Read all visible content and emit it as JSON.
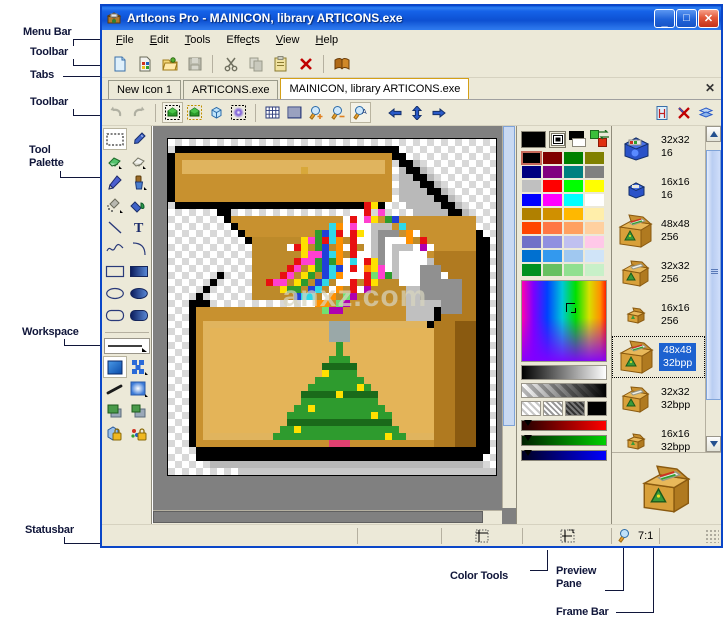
{
  "annotations": [
    {
      "id": "menu-bar",
      "text": "Menu Bar"
    },
    {
      "id": "toolbar-top",
      "text": "Toolbar"
    },
    {
      "id": "tabs",
      "text": "Tabs"
    },
    {
      "id": "toolbar-2",
      "text": "Toolbar"
    },
    {
      "id": "tool-palette",
      "text": "Tool\nPalette"
    },
    {
      "id": "workspace",
      "text": "Workspace"
    },
    {
      "id": "statusbar",
      "text": "Statusbar"
    },
    {
      "id": "color-tools",
      "text": "Color Tools"
    },
    {
      "id": "preview-pane",
      "text": "Preview\nPane"
    },
    {
      "id": "frame-bar",
      "text": "Frame Bar"
    }
  ],
  "window": {
    "title": "ArtIcons Pro - MAINICON, library ARTICONS.exe",
    "minimize_label": "_",
    "maximize_label": "□",
    "close_label": "✕",
    "titlebar_color": "#0b5ae0"
  },
  "menubar": {
    "items": [
      {
        "label": "File",
        "accel": "F"
      },
      {
        "label": "Edit",
        "accel": "E"
      },
      {
        "label": "Tools",
        "accel": "T"
      },
      {
        "label": "Effects",
        "accel": "c"
      },
      {
        "label": "View",
        "accel": "V"
      },
      {
        "label": "Help",
        "accel": "H"
      }
    ]
  },
  "toolbar_main": {
    "buttons": [
      {
        "name": "new-icon-button",
        "icon": "new-document-icon"
      },
      {
        "name": "new-library-button",
        "icon": "new-library-icon"
      },
      {
        "name": "open-button",
        "icon": "open-folder-icon"
      },
      {
        "name": "save-button",
        "icon": "floppy-disk-icon",
        "disabled": true
      },
      {
        "name": "cut-button",
        "icon": "scissors-icon"
      },
      {
        "name": "copy-button",
        "icon": "copy-icon",
        "disabled": true
      },
      {
        "name": "paste-button",
        "icon": "clipboard-icon"
      },
      {
        "name": "delete-button",
        "icon": "red-x-icon"
      },
      {
        "name": "help-button",
        "icon": "book-icon"
      }
    ]
  },
  "tabs": {
    "items": [
      {
        "label": "New Icon 1",
        "active": false
      },
      {
        "label": "ARTICONS.exe",
        "active": false
      },
      {
        "label": "MAINICON, library ARTICONS.exe",
        "active": true
      }
    ],
    "close_label": "✕"
  },
  "toolbar_edit": {
    "buttons": [
      {
        "name": "undo-button",
        "icon": "undo-arrow-icon"
      },
      {
        "name": "redo-button",
        "icon": "redo-arrow-icon"
      },
      {
        "name": "image-normal-button",
        "icon": "green-cube-icon",
        "selected": true
      },
      {
        "name": "image-selected-button",
        "icon": "green-cube-dashed-icon"
      },
      {
        "name": "image-3d-button",
        "icon": "blue-cube-icon"
      },
      {
        "name": "blur-button",
        "icon": "blur-blob-icon"
      },
      {
        "name": "grid-button",
        "icon": "grid-icon"
      },
      {
        "name": "fine-grid-button",
        "icon": "fine-grid-icon"
      },
      {
        "name": "zoom-in-button",
        "icon": "magnifier-plus-icon"
      },
      {
        "name": "zoom-out-button",
        "icon": "magnifier-minus-icon"
      },
      {
        "name": "zoom-actual-button",
        "icon": "magnifier-a-icon",
        "selected": true
      },
      {
        "name": "nudge-left-button",
        "icon": "arrow-left-icon"
      },
      {
        "name": "nudge-vertical-button",
        "icon": "arrow-updown-icon"
      },
      {
        "name": "nudge-right-button",
        "icon": "arrow-right-icon"
      },
      {
        "name": "add-frame-button",
        "icon": "add-frame-icon"
      },
      {
        "name": "delete-frame-button",
        "icon": "delete-frame-icon"
      },
      {
        "name": "layers-button",
        "icon": "layers-icon"
      }
    ]
  },
  "tool_palette": {
    "tools": [
      {
        "name": "select-rectangle-tool",
        "icon": "marquee-icon",
        "selected": true
      },
      {
        "name": "color-picker-tool",
        "icon": "eyedropper-icon",
        "selected": false
      },
      {
        "name": "eraser-tool",
        "icon": "eraser-green-icon",
        "selected": false
      },
      {
        "name": "erase-all-tool",
        "icon": "eraser-white-icon",
        "selected": false
      },
      {
        "name": "pencil-tool",
        "icon": "pencil-icon",
        "selected": false
      },
      {
        "name": "brush-tool",
        "icon": "paintbrush-icon",
        "selected": false
      },
      {
        "name": "airbrush-tool",
        "icon": "airbrush-icon",
        "selected": false
      },
      {
        "name": "paint-bucket-tool",
        "icon": "paint-bucket-icon",
        "selected": false
      },
      {
        "name": "line-tool",
        "icon": "line-icon",
        "selected": false
      },
      {
        "name": "text-tool",
        "icon": "text-t-icon",
        "selected": false
      },
      {
        "name": "curve-tool",
        "icon": "wave-icon",
        "selected": false
      },
      {
        "name": "arc-tool",
        "icon": "arc-icon",
        "selected": false
      },
      {
        "name": "rectangle-tool",
        "icon": "rectangle-outline-icon",
        "selected": false
      },
      {
        "name": "rectangle-filled-tool",
        "icon": "rectangle-filled-icon",
        "selected": false
      },
      {
        "name": "ellipse-tool",
        "icon": "ellipse-outline-icon",
        "selected": false
      },
      {
        "name": "ellipse-filled-tool",
        "icon": "ellipse-filled-icon",
        "selected": false
      },
      {
        "name": "rounded-rect-tool",
        "icon": "rounded-rect-outline-icon",
        "selected": false
      },
      {
        "name": "rounded-rect-filled-tool",
        "icon": "rounded-rect-filled-icon",
        "selected": false
      }
    ],
    "options": [
      {
        "name": "line-width-selector",
        "icon": "line-width-icon"
      },
      {
        "name": "fill-solid-option",
        "icon": "solid-fill-icon",
        "selected": true
      },
      {
        "name": "fill-pattern-option",
        "icon": "pattern-fill-icon"
      },
      {
        "name": "stroke-style-option",
        "icon": "stroke-style-icon"
      },
      {
        "name": "gradient-fill-option",
        "icon": "gradient-fill-icon"
      },
      {
        "name": "opaque-option",
        "icon": "opaque-layers-icon"
      },
      {
        "name": "transparent-option",
        "icon": "transparent-layers-icon"
      },
      {
        "name": "lock-image-option",
        "icon": "lock-blue-icon"
      },
      {
        "name": "lock-colors-option",
        "icon": "lock-colors-icon"
      }
    ]
  },
  "canvas": {
    "watermark": "anxz.com",
    "zoom": "7:1"
  },
  "color_tools": {
    "foreground_color": "#000000",
    "background_color": "#ffffff",
    "mode_icon": "draw-mode-icon",
    "swap_icon": "swap-colors-icon",
    "palette_rows": [
      [
        "#000000",
        "#800000",
        "#008000",
        "#808000"
      ],
      [
        "#000080",
        "#800080",
        "#008080",
        "#808080"
      ],
      [
        "#c0c0c0",
        "#ff0000",
        "#00ff00",
        "#ffff00"
      ],
      [
        "#0000ff",
        "#ff00ff",
        "#00ffff",
        "#ffffff"
      ],
      [
        "#b08000",
        "#d09000",
        "#ffb800",
        "#ffeeaa"
      ],
      [
        "#ff4500",
        "#ff7744",
        "#ffa060",
        "#ffd0a0"
      ],
      [
        "#7070c8",
        "#9090e0",
        "#c0c0f0",
        "#ffc8e8"
      ],
      [
        "#0070d0",
        "#3399ee",
        "#a0c8f0",
        "#d0e4f8"
      ],
      [
        "#009020",
        "#66c060",
        "#90e090",
        "#c8f0c8"
      ]
    ],
    "selected_swatch_index": 0,
    "alpha_patterns": [
      "pattern-12",
      "pattern-50",
      "pattern-75",
      "solid-black"
    ],
    "channels": [
      {
        "name": "red-channel",
        "color": "#ff0000"
      },
      {
        "name": "green-channel",
        "color": "#00c000"
      },
      {
        "name": "blue-channel",
        "color": "#0000ff"
      }
    ]
  },
  "frame_bar": {
    "frames": [
      {
        "size": "32x32",
        "depth": "16",
        "icon": "blue-box-32-icon",
        "selected": false
      },
      {
        "size": "16x16",
        "depth": "16",
        "icon": "blue-box-16-icon",
        "selected": false
      },
      {
        "size": "48x48",
        "depth": "256",
        "icon": "gold-box-48-icon",
        "selected": false
      },
      {
        "size": "32x32",
        "depth": "256",
        "icon": "gold-box-32-icon",
        "selected": false
      },
      {
        "size": "16x16",
        "depth": "256",
        "icon": "gold-box-16-icon",
        "selected": false
      },
      {
        "size": "48x48",
        "depth": "32bpp",
        "icon": "gold-box-48-icon",
        "selected": true
      },
      {
        "size": "32x32",
        "depth": "32bpp",
        "icon": "gold-box-32-icon",
        "selected": false
      },
      {
        "size": "16x16",
        "depth": "32bpp",
        "icon": "gold-box-16-icon",
        "selected": false
      }
    ],
    "scroll_up_label": "▲",
    "scroll_down_label": "▼"
  },
  "preview": {
    "icon": "gold-toolbox-preview-icon"
  },
  "statusbar": {
    "message": "",
    "cursor_pos": "",
    "selection_icon": "crop-cursor-icon",
    "size_icon": "selection-size-icon",
    "zoom_icon": "magnifier-icon",
    "zoom_value": "7:1"
  }
}
